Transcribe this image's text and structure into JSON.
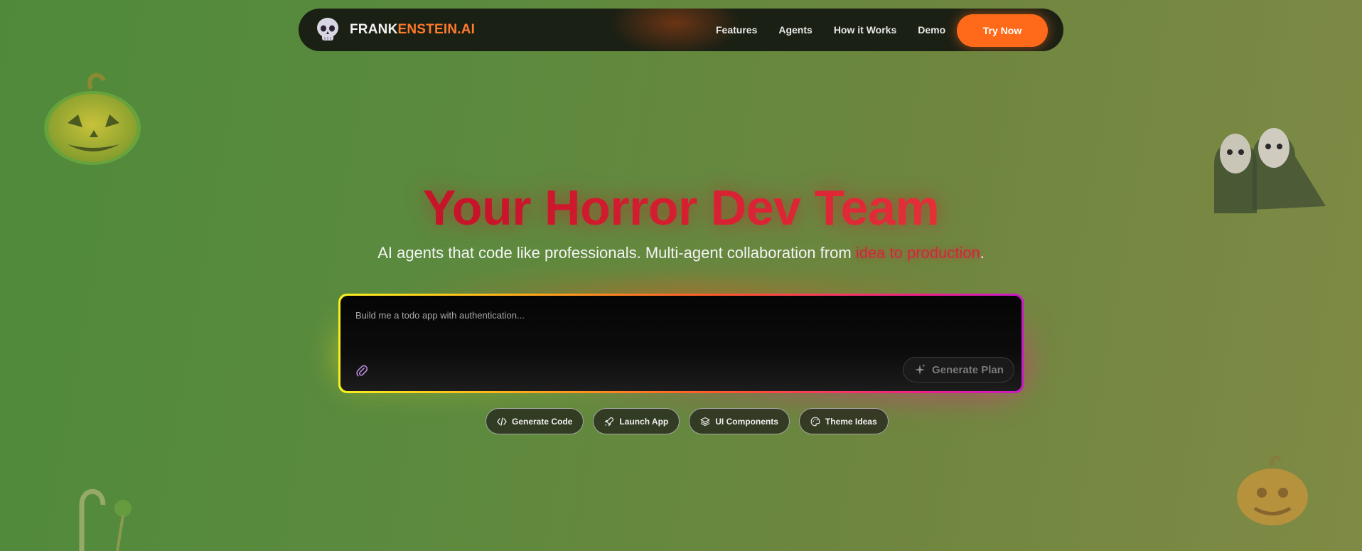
{
  "nav": {
    "logo_part1": "FRANK",
    "logo_part2": "ENSTEIN.AI",
    "links": [
      "Features",
      "Agents",
      "How it Works",
      "Demo"
    ],
    "cta": "Try Now"
  },
  "hero": {
    "title": "Your Horror Dev Team",
    "subtitle_before": "AI agents that code like professionals. Multi-agent collaboration from ",
    "subtitle_highlight": "idea to production",
    "subtitle_after": "."
  },
  "prompt": {
    "placeholder": "Build me a todo app with authentication...",
    "generate_label": "Generate Plan"
  },
  "chips": [
    {
      "label": "Generate Code",
      "icon": "code-icon"
    },
    {
      "label": "Launch App",
      "icon": "rocket-icon"
    },
    {
      "label": "UI Components",
      "icon": "layers-icon"
    },
    {
      "label": "Theme Ideas",
      "icon": "palette-icon"
    }
  ],
  "colors": {
    "accent": "#ff6a1a",
    "title_red": "#c8142a",
    "background": "#5c8a3e"
  }
}
